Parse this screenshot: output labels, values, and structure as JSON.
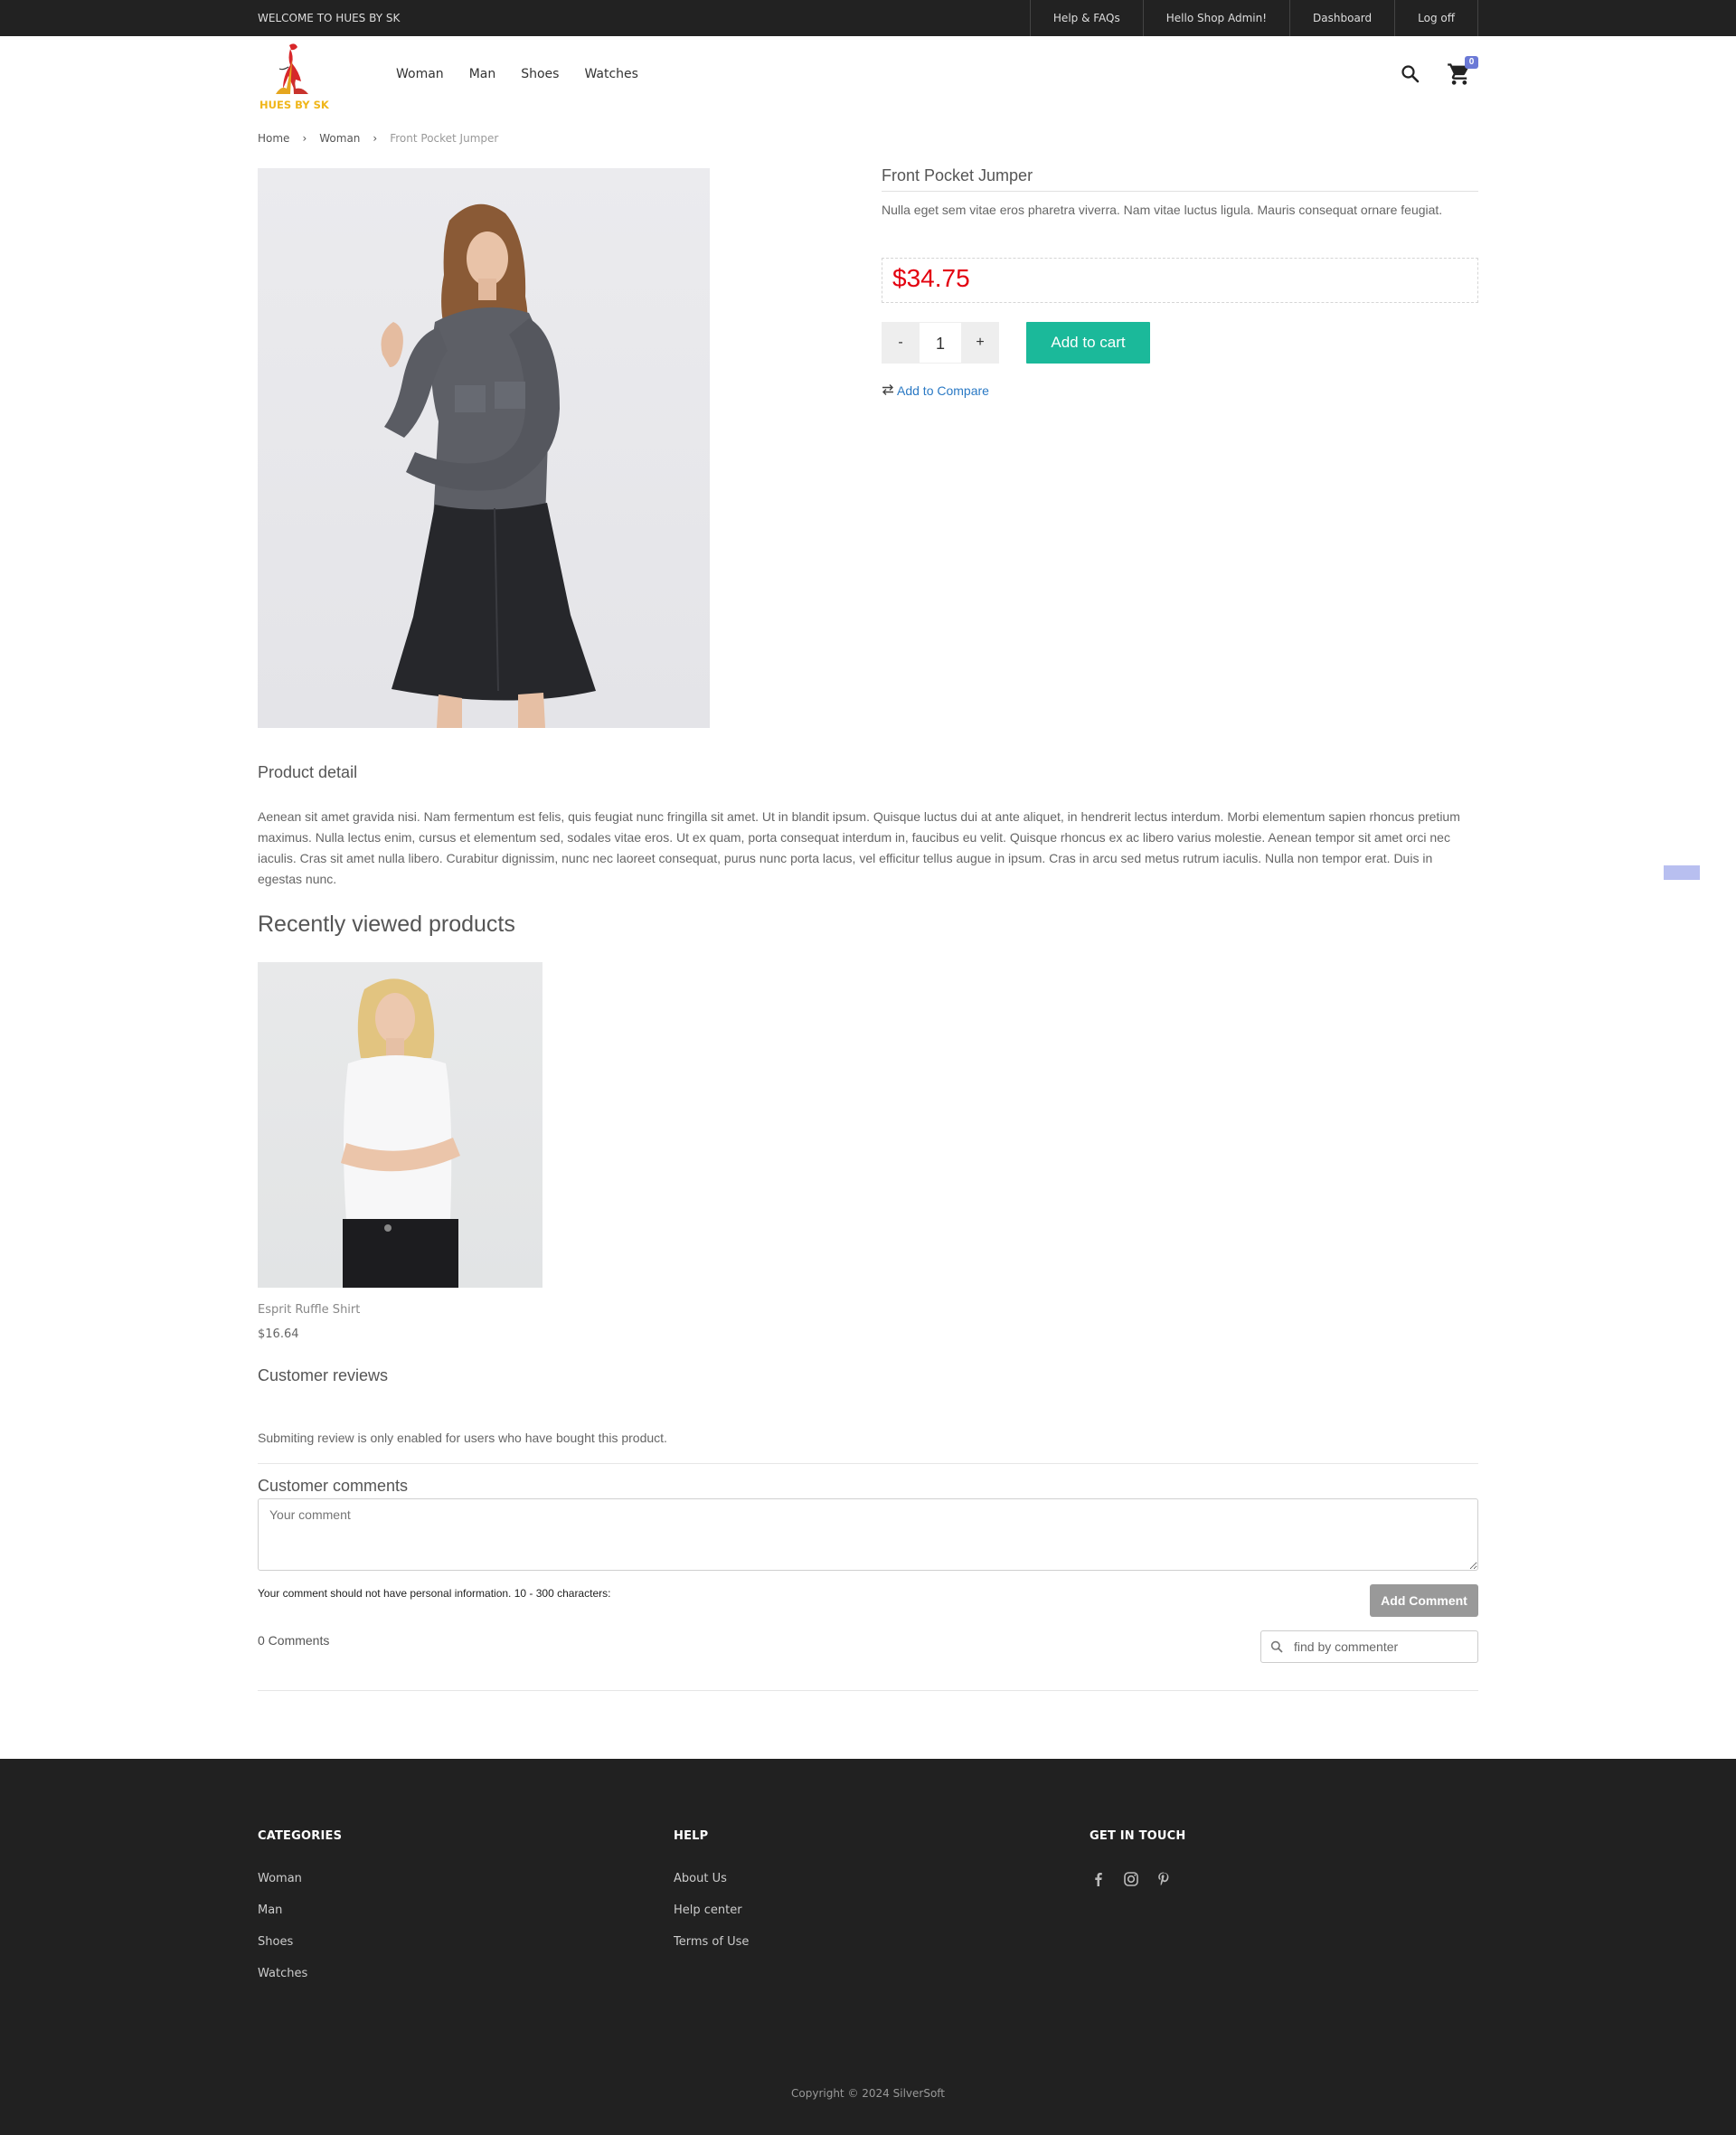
{
  "topbar": {
    "welcome": "WELCOME TO HUES BY SK",
    "links": [
      "Help & FAQs",
      "Hello Shop Admin!",
      "Dashboard",
      "Log off"
    ]
  },
  "header": {
    "logo_text": "HUES BY SK",
    "nav": [
      "Woman",
      "Man",
      "Shoes",
      "Watches"
    ],
    "cart_count": "0"
  },
  "breadcrumb": [
    "Home",
    "Woman",
    "Front Pocket Jumper"
  ],
  "product": {
    "title": "Front Pocket Jumper",
    "short_description": "Nulla eget sem vitae eros pharetra viverra. Nam vitae luctus ligula. Mauris consequat ornare feugiat.",
    "price": "$34.75",
    "qty_minus": "-",
    "qty_value": "1",
    "qty_plus": "+",
    "add_to_cart": "Add to cart",
    "compare": "Add to Compare"
  },
  "detail": {
    "title": "Product detail",
    "text": "Aenean sit amet gravida nisi. Nam fermentum est felis, quis feugiat nunc fringilla sit amet. Ut in blandit ipsum. Quisque luctus dui at ante aliquet, in hendrerit lectus interdum. Morbi elementum sapien rhoncus pretium maximus. Nulla lectus enim, cursus et elementum sed, sodales vitae eros. Ut ex quam, porta consequat interdum in, faucibus eu velit. Quisque rhoncus ex ac libero varius molestie. Aenean tempor sit amet orci nec iaculis. Cras sit amet nulla libero. Curabitur dignissim, nunc nec laoreet consequat, purus nunc porta lacus, vel efficitur tellus augue in ipsum. Cras in arcu sed metus rutrum iaculis. Nulla non tempor erat. Duis in egestas nunc."
  },
  "recent": {
    "title": "Recently viewed products",
    "items": [
      {
        "name": "Esprit Ruffle Shirt",
        "price": "$16.64"
      }
    ]
  },
  "reviews": {
    "title": "Customer reviews",
    "note": "Submiting review is only enabled for users who have bought this product."
  },
  "comments": {
    "title": "Customer comments",
    "placeholder": "Your comment",
    "hint": "Your comment should not have personal information. 10 - 300 characters:",
    "add_button": "Add Comment",
    "count": "0 Comments",
    "find_placeholder": "find by commenter"
  },
  "footer": {
    "categories_title": "CATEGORIES",
    "categories": [
      "Woman",
      "Man",
      "Shoes",
      "Watches"
    ],
    "help_title": "HELP",
    "help": [
      "About Us",
      "Help center",
      "Terms of Use"
    ],
    "touch_title": "GET IN TOUCH",
    "social_icons": [
      "facebook-icon",
      "instagram-icon",
      "pinterest-icon"
    ],
    "copyright": "Copyright © 2024 SilverSoft"
  },
  "colors": {
    "topbar_bg": "#222222",
    "accent_green": "#1bb99a",
    "price_red": "#e3000f",
    "link_blue": "#2a79c4",
    "footer_bg": "#212121",
    "badge": "#6b79d6"
  }
}
